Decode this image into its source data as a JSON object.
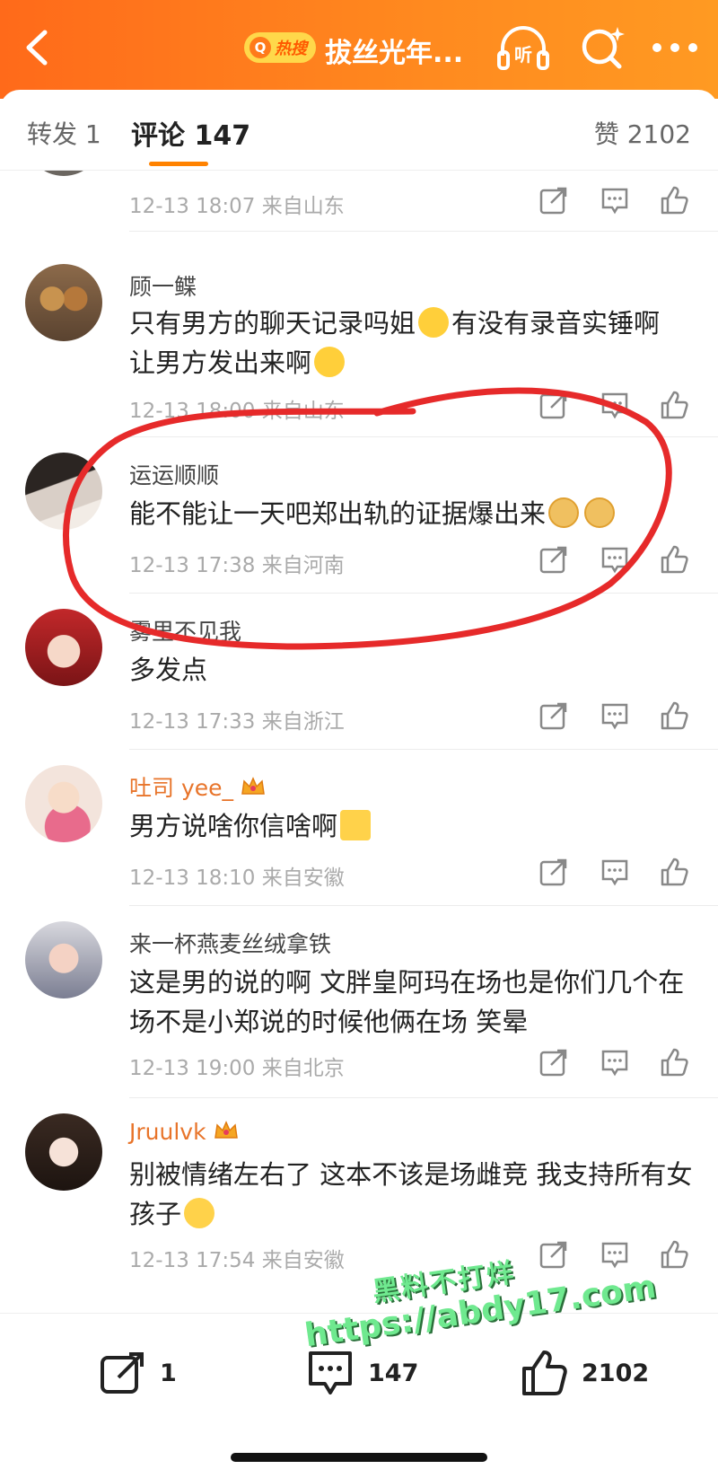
{
  "header": {
    "hot_badge": "热搜",
    "title": "拔丝光年..."
  },
  "tabs": {
    "repost": "转发 1",
    "comment": "评论 147",
    "like": "赞 2102"
  },
  "comments": [
    {
      "name": "",
      "text": "",
      "meta": "12-13 18:07 来自山东"
    },
    {
      "name": "顾一鲽",
      "text": "只有男方的聊天记录吗姐",
      "text2": "有没有录音实锤啊",
      "text3": "让男方发出来啊",
      "meta": "12-13 18:00 来自山东"
    },
    {
      "name": "运运顺顺",
      "text": "能不能让一天吧郑出轨的证据爆出来",
      "meta": "12-13 17:38 来自河南"
    },
    {
      "name": "雾里不见我",
      "text": "多发点",
      "meta": "12-13 17:33 来自浙江"
    },
    {
      "name": "吐司 yee_",
      "text": "男方说啥你信啥啊",
      "meta": "12-13 18:10 来自安徽"
    },
    {
      "name": "来一杯燕麦丝绒拿铁",
      "text": "这是男的说的啊 文胖皇阿玛在场也是你们几个在场不是小郑说的时候他俩在场 笑晕",
      "meta": "12-13 19:00 来自北京"
    },
    {
      "name": "Jruulvk",
      "text": "别被情绪左右了 这本不该是场雌竞 我支持所有女孩子",
      "meta": "12-13 17:54 来自安徽"
    }
  ],
  "bottom": {
    "repost_count": "1",
    "comment_count": "147",
    "like_count": "2102"
  },
  "watermark": {
    "line1": "黑料不打烊",
    "line2": "https://abdy17.com"
  }
}
